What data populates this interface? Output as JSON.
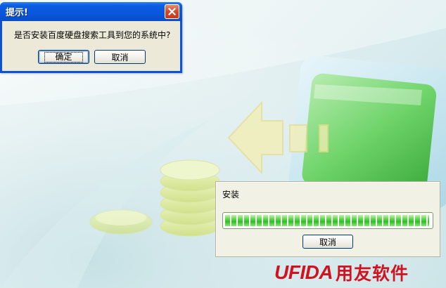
{
  "prompt_dialog": {
    "title": "提示!",
    "message": "是否安装百度硬盘搜索工具到您的系统中?",
    "ok_label": "确定",
    "cancel_label": "取消",
    "close_icon": "close-icon"
  },
  "installer": {
    "status_label": "安装",
    "progress": 1.0,
    "cancel_label": "取消"
  },
  "branding": {
    "logo_latin": "UFIDA",
    "logo_cjk": "用友软件",
    "color": "#d2121e"
  },
  "colors": {
    "xp_titlebar": "#0a56dc",
    "dialog_face": "#ece9d8",
    "progress_green": "#2fbf22",
    "background": "#d4e9ec"
  }
}
